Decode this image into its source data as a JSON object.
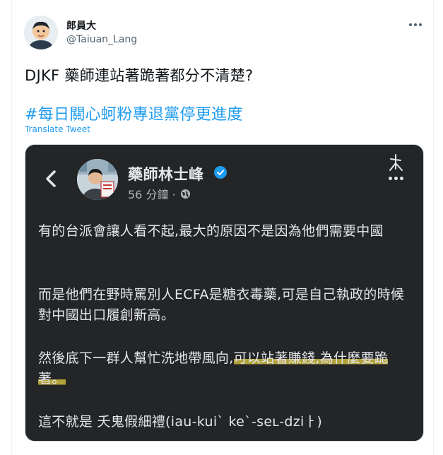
{
  "tweet": {
    "author_name": "郎員大",
    "author_handle": "@Taiuan_Lang",
    "text": "DJKF 藥師連站著跪著都分不清楚?",
    "hashtag": "#每日關心蚵粉專退黨停更進度",
    "translate_label": "Translate Tweet"
  },
  "post": {
    "name": "藥師林士峰",
    "time": "56 分鐘 ·",
    "paragraphs": {
      "p1": "有的台派會讓人看不起,最大的原因不是因為他們需要中國",
      "p2": "而是他們在野時罵別人ECFA是糖衣毒藥,可是自己執政的時候對中國出口履創新高。",
      "p3_before": "然後底下一群人幫忙洗地帶風向,",
      "p3_highlight": "可以站著賺錢,為什麼要跪著。",
      "p4": "這不就是 夭鬼假細禮(iau-kui` ke`-seʟ-dziㅏ)"
    }
  },
  "colors": {
    "link": "#1d9bf0",
    "media_bg": "#242526",
    "highlight": "#d4c03e",
    "verified": "#1d9bf0"
  }
}
